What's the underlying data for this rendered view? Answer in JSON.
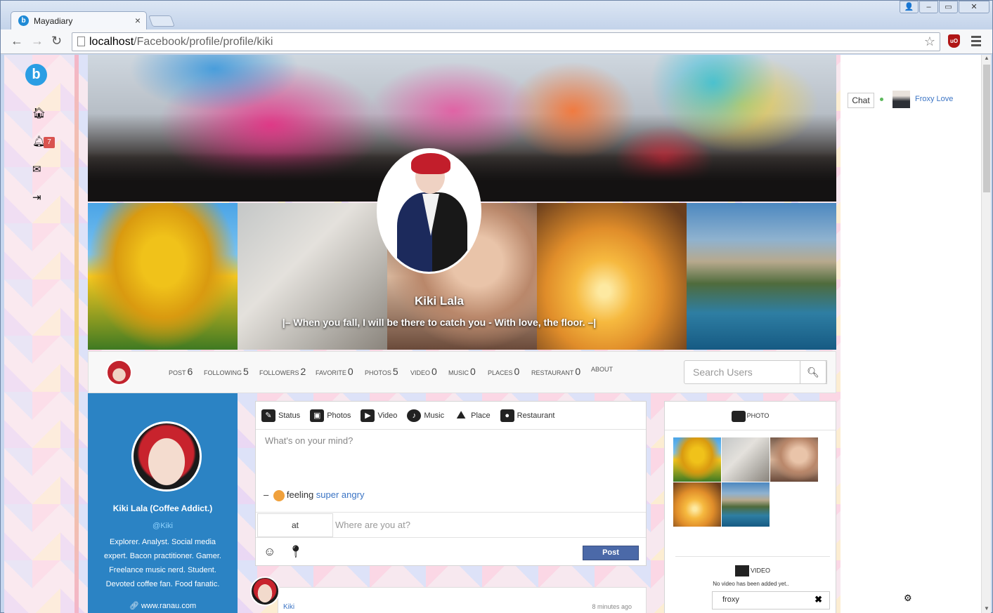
{
  "browser": {
    "tab_title": "Mayadiary",
    "tab_icon": "b",
    "url_host": "localhost",
    "url_path": "/Facebook/profile/profile/kiki",
    "window_buttons": [
      "minimize",
      "maximize",
      "close"
    ]
  },
  "sidebar": {
    "logo": "b",
    "items": [
      {
        "name": "home",
        "icon": "home-icon",
        "glyph": "⌂"
      },
      {
        "name": "notifications",
        "icon": "bell-icon",
        "glyph": "🔔",
        "badge": "7"
      },
      {
        "name": "messages",
        "icon": "envelope-icon",
        "glyph": "✉"
      },
      {
        "name": "logout",
        "icon": "sign-in-icon",
        "glyph": "⇥"
      }
    ]
  },
  "profile": {
    "name": "Kiki Lala",
    "quote": "|– When you fall, I will be there to catch you - With love, the floor. –|",
    "full_name": "Kiki Lala (Coffee Addict.)",
    "handle": "@Kiki",
    "bio": "Explorer. Analyst. Social media expert. Bacon practitioner. Gamer. Freelance music nerd. Student. Devoted coffee fan. Food fanatic.",
    "website": "www.ranau.com"
  },
  "stats": [
    {
      "label": "POST",
      "value": "6"
    },
    {
      "label": "FOLLOWING",
      "value": "5"
    },
    {
      "label": "FOLLOWERS",
      "value": "2"
    },
    {
      "label": "FAVORITE",
      "value": "0"
    },
    {
      "label": "PHOTOS",
      "value": "5"
    },
    {
      "label": "VIDEO",
      "value": "0"
    },
    {
      "label": "MUSIC",
      "value": "0"
    },
    {
      "label": "PLACES",
      "value": "0"
    },
    {
      "label": "RESTAURANT",
      "value": "0"
    },
    {
      "label": "ABOUT",
      "value": ""
    }
  ],
  "search": {
    "placeholder": "Search Users"
  },
  "composer": {
    "tabs": [
      {
        "label": "Status",
        "icon": "pencil-icon"
      },
      {
        "label": "Photos",
        "icon": "photos-icon"
      },
      {
        "label": "Video",
        "icon": "film-icon"
      },
      {
        "label": "Music",
        "icon": "music-icon"
      },
      {
        "label": "Place",
        "icon": "map-icon"
      },
      {
        "label": "Restaurant",
        "icon": "restaurant-icon"
      }
    ],
    "placeholder": "What's on your mind?",
    "feeling_prefix": "–",
    "feeling_label": "feeling",
    "feeling_value": "super angry",
    "at_label": "at",
    "location_placeholder": "Where are you at?",
    "post_button": "Post"
  },
  "feed": [
    {
      "user": "Kiki",
      "time": "8 minutes ago"
    }
  ],
  "photo_panel": {
    "title": "PHOTO",
    "video_title": "VIDEO",
    "no_video_text": "No video has been added yet.."
  },
  "chat": {
    "button": "Chat",
    "contact": "Froxy Love",
    "input_value": "froxy"
  },
  "colors": {
    "accent": "#2b83c4",
    "post_button": "#4b69a8",
    "badge": "#d9534f",
    "link": "#3b74c4",
    "online": "#5cb85c"
  }
}
